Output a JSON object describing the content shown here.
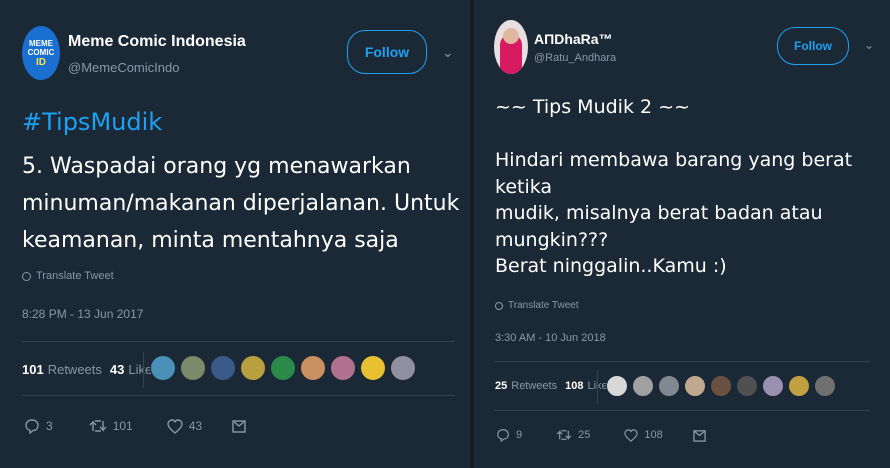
{
  "left": {
    "name": "Meme Comic Indonesia",
    "handle": "@MemeComicIndo",
    "avatar_text": [
      "MEME",
      "COMIC",
      "ID"
    ],
    "follow_label": "Follow",
    "hashtag": "#TipsMudik",
    "body": "5. Waspadai orang yg menawarkan\nminuman/makanan diperjalanan. Untuk\nkeamanan, minta mentahnya saja",
    "translate_label": "Translate Tweet",
    "timestamp": "8:28 PM - 13 Jun 2017",
    "retweets_count": "101",
    "retweets_label": "Retweets",
    "likes_count": "43",
    "likes_label": "Likes",
    "liker_colors": [
      "#4a90b8",
      "#7a8a6a",
      "#3a5a8a",
      "#b8a040",
      "#2a8a4a",
      "#c89060",
      "#b07090",
      "#e8c030",
      "#9090a0"
    ],
    "reply_count": "3",
    "retweet_action_count": "101",
    "like_action_count": "43"
  },
  "right": {
    "name": "ΑΠDhaRa™",
    "handle": "@Ratu_Andhara",
    "follow_label": "Follow",
    "body": "~~ Tips Mudik 2 ~~\n\nHindari membawa barang yang berat ketika\nmudik, misalnya berat badan atau\nmungkin???\nBerat ninggalin..Kamu :)",
    "translate_label": "Translate Tweet",
    "timestamp": "3:30 AM - 10 Jun 2018",
    "retweets_count": "25",
    "retweets_label": "Retweets",
    "likes_count": "108",
    "likes_label": "Likes",
    "liker_colors": [
      "#d8d8d8",
      "#a0a0a0",
      "#808890",
      "#c0a890",
      "#6a5040",
      "#505050",
      "#9a90b0",
      "#c0a040",
      "#707070"
    ],
    "reply_count": "9",
    "retweet_action_count": "25",
    "like_action_count": "108"
  },
  "colors": {
    "background": "#1b2836",
    "accent": "#1da1f2",
    "muted": "#8899a6"
  }
}
